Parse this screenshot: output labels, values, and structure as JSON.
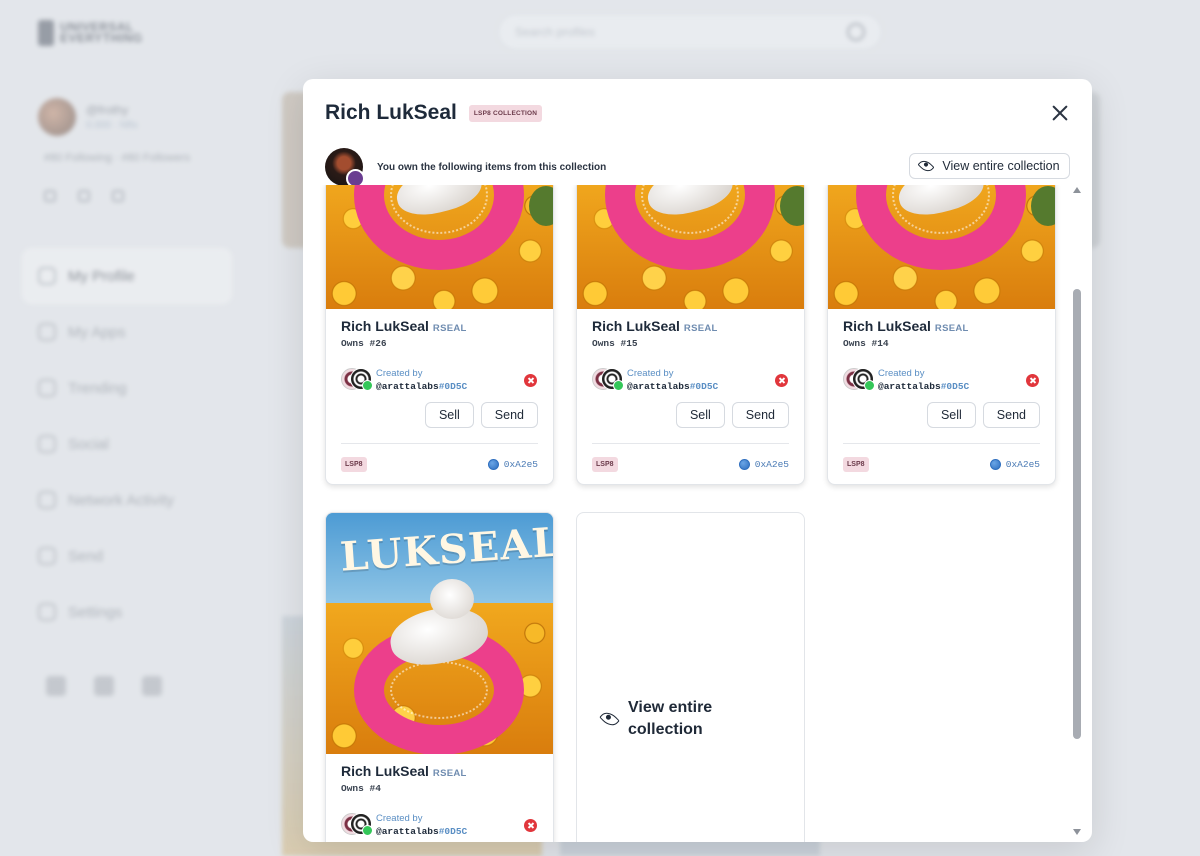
{
  "background": {
    "logo_text": "UNIVERSAL\nEVERYTHING",
    "search_placeholder": "Search profiles",
    "profile_name": "@frothy",
    "profile_sub": "0.000 · Nfts",
    "follow_stats": "#80 Following · #80 Followers",
    "nav": [
      "My Profile",
      "My Apps",
      "Trending",
      "Social",
      "Network Activity",
      "Send",
      "Settings"
    ]
  },
  "modal": {
    "title": "Rich LukSeal",
    "collection_tag": "LSP8 COLLECTION",
    "own_text": "You own the following items from this collection",
    "view_button": "View entire collection",
    "view_card_text": "View entire collection"
  },
  "items": [
    {
      "name": "Rich LukSeal",
      "symbol": "RSEAL",
      "owns": "Owns #26",
      "created_by": "Created by",
      "creator": "@arattalabs",
      "creator_hash": "#0D5C",
      "sell": "Sell",
      "send": "Send",
      "tag": "LSP8",
      "address": "0xA2e5"
    },
    {
      "name": "Rich LukSeal",
      "symbol": "RSEAL",
      "owns": "Owns #15",
      "created_by": "Created by",
      "creator": "@arattalabs",
      "creator_hash": "#0D5C",
      "sell": "Sell",
      "send": "Send",
      "tag": "LSP8",
      "address": "0xA2e5"
    },
    {
      "name": "Rich LukSeal",
      "symbol": "RSEAL",
      "owns": "Owns #14",
      "created_by": "Created by",
      "creator": "@arattalabs",
      "creator_hash": "#0D5C",
      "sell": "Sell",
      "send": "Send",
      "tag": "LSP8",
      "address": "0xA2e5"
    },
    {
      "name": "Rich LukSeal",
      "symbol": "RSEAL",
      "owns": "Owns #4",
      "created_by": "Created by",
      "creator": "@arattalabs",
      "creator_hash": "#0D5C",
      "image_text": "LUKSEALS"
    }
  ],
  "colors": {
    "tag_bg": "#f3d9e0",
    "accent_blue": "#5b8fc4",
    "remove_red": "#e1363c",
    "ring_pink": "#ec3f8b"
  },
  "icons": [
    "close-icon",
    "eye-icon",
    "remove-icon",
    "globe-icon",
    "chevron-up-icon",
    "chevron-down-icon"
  ]
}
